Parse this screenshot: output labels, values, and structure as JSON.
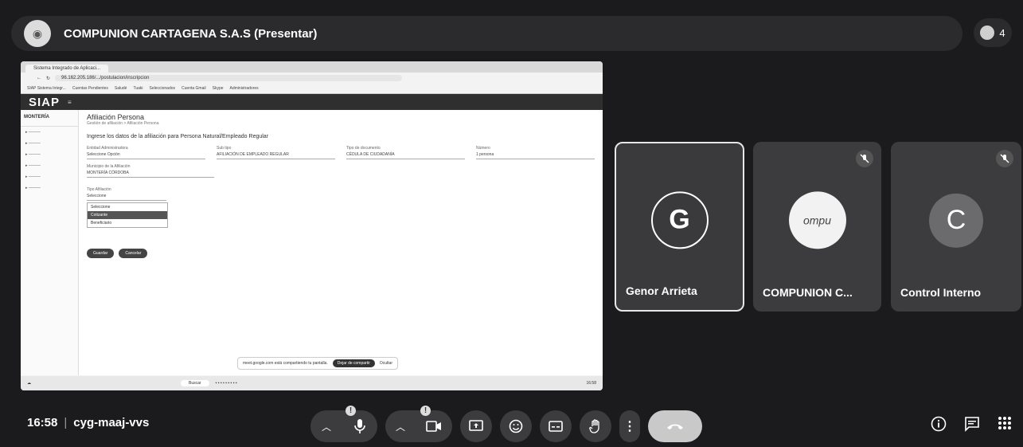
{
  "presenter": {
    "title": "COMPUNION CARTAGENA S.A.S (Presentar)",
    "participant_count": "4"
  },
  "shared_screen": {
    "tab_title": "Sistema Integrado de Aplicaci...",
    "url": "96.162.205.186/.../postulacion/inscripcion",
    "bookmarks": [
      "SIAP Sistema Integr...",
      "Cuentas Pendientes",
      "Saludé",
      "Tuaki",
      "Seleccionados",
      "Cuenta Gmail",
      "Skype",
      "Administradores"
    ],
    "app_logo": "SIAP",
    "city_logo": "MONTERÍA",
    "page_title": "Afiliación Persona",
    "breadcrumb": "Gestión de afiliación  >  Afiliación Persona",
    "heading": "Ingrese los datos de la afiliación para Persona Natural/Empleado Regular",
    "fields": [
      {
        "label": "Entidad Administradora",
        "value": "Seleccione Opción"
      },
      {
        "label": "Sub tipo",
        "value": "AFILIACIÓN DE EMPLEADO REGULAR"
      },
      {
        "label": "Tipo de documento",
        "value": "CÉDULA DE CIUDADANÍA"
      },
      {
        "label": "Número",
        "value": "1 persona"
      }
    ],
    "subfield_label": "Municipio de la Afiliación",
    "subfield_value": "MONTERÍA CÓRDOBA",
    "select_label": "Tipo Afiliación",
    "select_value": "Seleccione",
    "dropdown_options": [
      "Seleccione",
      "Cotizante",
      "Beneficiario"
    ],
    "buttons": [
      "Guardar",
      "Cancelar"
    ],
    "hint_text": "meet.google.com está compartiendo tu pantalla.",
    "hint_stop": "Dejar de compartir",
    "hint_hide": "Ocultar",
    "taskbar_search": "Buscar",
    "taskbar_time": "16:58"
  },
  "participants": [
    {
      "initial": "G",
      "name": "Genor Arrieta",
      "muted": false,
      "active": true
    },
    {
      "initial": "",
      "name": "COMPUNION C...",
      "muted": true,
      "logo_text": "ompu"
    },
    {
      "initial": "C",
      "name": "Control Interno",
      "muted": true
    }
  ],
  "meeting": {
    "time": "16:58",
    "code": "cyg-maaj-vvs"
  },
  "controls": {
    "mic_warning": "!",
    "cam_warning": "!"
  },
  "colors": {
    "background": "#1b1b1d",
    "tile": "#3c3c3f",
    "hangup": "#c9c9c9"
  }
}
